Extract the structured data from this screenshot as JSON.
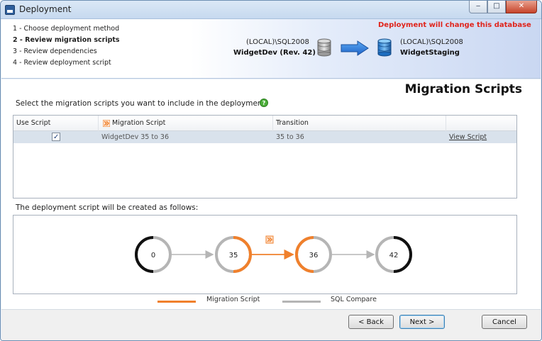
{
  "window": {
    "title": "Deployment"
  },
  "steps": [
    {
      "label": "1 - Choose deployment method",
      "active": false
    },
    {
      "label": "2 - Review migration scripts",
      "active": true
    },
    {
      "label": "3 - Review dependencies",
      "active": false
    },
    {
      "label": "4 - Review deployment script",
      "active": false
    }
  ],
  "header": {
    "warning": "Deployment will change this database",
    "source_server": "(LOCAL)\\SQL2008",
    "source_db": "WidgetDev (Rev. 42)",
    "target_server": "(LOCAL)\\SQL2008",
    "target_db": "WidgetStaging"
  },
  "page": {
    "title": "Migration Scripts",
    "instruction": "Select the migration scripts you want to include in the deployment:",
    "deployment_label": "The deployment script will be created as follows:"
  },
  "grid": {
    "columns": [
      "Use Script",
      "Migration Script",
      "Transition",
      ""
    ],
    "rows": [
      {
        "use": true,
        "script": "WidgetDev 35 to 36",
        "transition": "35 to 36",
        "action": "View Script"
      }
    ]
  },
  "diagram": {
    "nodes": [
      "0",
      "35",
      "36",
      "42"
    ]
  },
  "legend": {
    "migration": "Migration Script",
    "compare": "SQL Compare"
  },
  "colors": {
    "migration": "#f0802c",
    "compare": "#b5b5b5",
    "node_dark": "#111111",
    "warning": "#e0241b"
  },
  "buttons": {
    "back": "< Back",
    "next": "Next >",
    "cancel": "Cancel"
  }
}
